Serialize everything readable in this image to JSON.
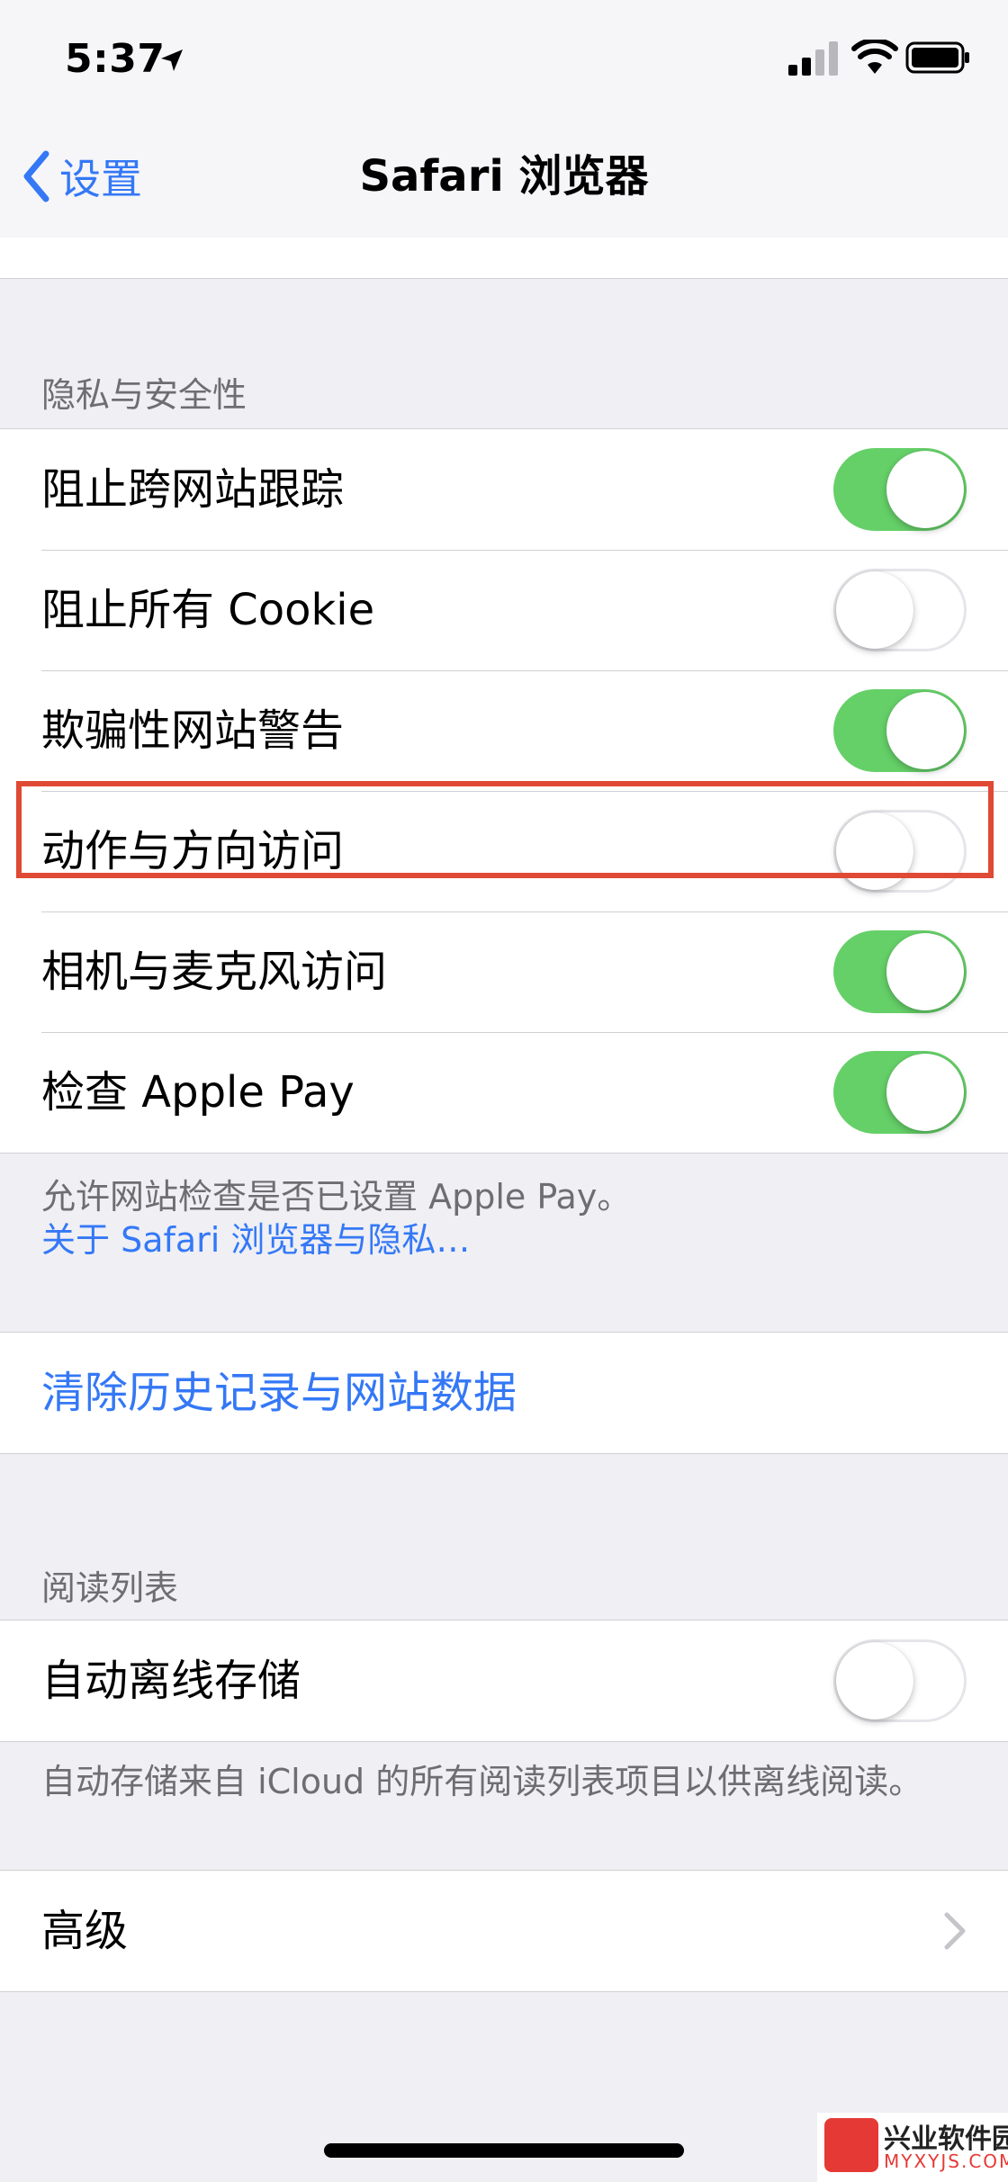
{
  "status": {
    "time": "5:37"
  },
  "nav": {
    "back_label": "设置",
    "title": "Safari 浏览器"
  },
  "privacy": {
    "header": "隐私与安全性",
    "items": [
      {
        "label": "阻止跨网站跟踪",
        "enabled": true
      },
      {
        "label": "阻止所有 Cookie",
        "enabled": false
      },
      {
        "label": "欺骗性网站警告",
        "enabled": true
      },
      {
        "label": "动作与方向访问",
        "enabled": false
      },
      {
        "label": "相机与麦克风访问",
        "enabled": true
      },
      {
        "label": "检查 Apple Pay",
        "enabled": true
      }
    ],
    "footer": "允许网站检查是否已设置 Apple Pay。",
    "footer_link": "关于 Safari 浏览器与隐私…"
  },
  "clear": {
    "label": "清除历史记录与网站数据"
  },
  "reading_list": {
    "header": "阅读列表",
    "item": {
      "label": "自动离线存储",
      "enabled": false
    },
    "footer": "自动存储来自 iCloud 的所有阅读列表项目以供离线阅读。"
  },
  "advanced": {
    "label": "高级"
  },
  "watermark": {
    "title": "兴业软件园",
    "subtitle": "MYXYJS.COM"
  },
  "colors": {
    "accent": "#3478f6",
    "switch_on": "#65d068",
    "highlight": "#e04a35"
  }
}
